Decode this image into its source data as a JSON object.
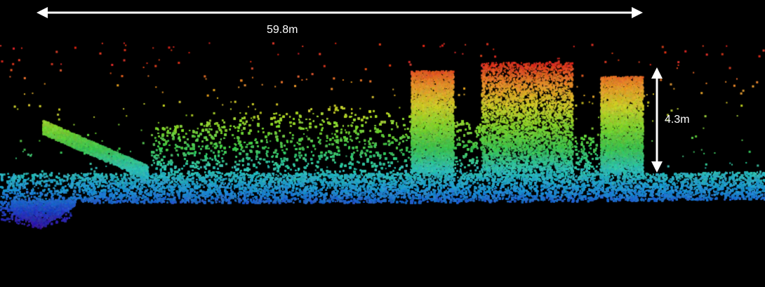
{
  "measurements": {
    "width_label": "59.8m",
    "height_label": "4.3m"
  },
  "colors": {
    "background": "#000000",
    "annotation": "#ffffff",
    "height_ramp": [
      "#3a0a8c",
      "#1f3fbf",
      "#1f8fd0",
      "#2fbfb0",
      "#3fbf4f",
      "#7fcf2f",
      "#c9c92a",
      "#e3902a",
      "#d8301f"
    ]
  },
  "icons": {
    "width_dimension": "double-arrow-horizontal-icon",
    "height_dimension": "double-arrow-vertical-icon"
  }
}
